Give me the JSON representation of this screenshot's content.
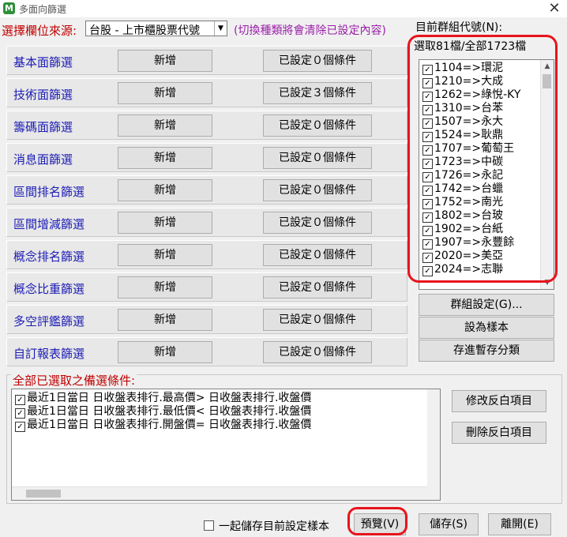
{
  "window": {
    "title": "多面向篩選",
    "app_icon": "M"
  },
  "source": {
    "label": "選擇欄位來源:",
    "value": "台股 - 上市櫃股票代號",
    "note": "(切換種類將會清除已設定內容)"
  },
  "filters": [
    {
      "label": "基本面篩選",
      "add": "新增",
      "count": "已設定０個條件"
    },
    {
      "label": "技術面篩選",
      "add": "新增",
      "count": "已設定３個條件"
    },
    {
      "label": "籌碼面篩選",
      "add": "新增",
      "count": "已設定０個條件"
    },
    {
      "label": "消息面篩選",
      "add": "新增",
      "count": "已設定０個條件"
    },
    {
      "label": "區間排名篩選",
      "add": "新增",
      "count": "已設定０個條件"
    },
    {
      "label": "區間增減篩選",
      "add": "新增",
      "count": "已設定０個條件"
    },
    {
      "label": "概念排名篩選",
      "add": "新增",
      "count": "已設定０個條件"
    },
    {
      "label": "概念比重篩選",
      "add": "新增",
      "count": "已設定０個條件"
    },
    {
      "label": "多空評鑑篩選",
      "add": "新增",
      "count": "已設定０個條件"
    },
    {
      "label": "自訂報表篩選",
      "add": "新增",
      "count": "已設定０個條件"
    }
  ],
  "group": {
    "label": "目前群組代號(N):",
    "count_text": "選取81檔/全部1723檔",
    "items": [
      "1104=>環泥",
      "1210=>大成",
      "1262=>綠悅-KY",
      "1310=>台苯",
      "1507=>永大",
      "1524=>耿鼎",
      "1707=>葡萄王",
      "1723=>中碳",
      "1726=>永記",
      "1742=>台蠟",
      "1752=>南光",
      "1802=>台玻",
      "1902=>台紙",
      "1907=>永豐餘",
      "2020=>美亞",
      "2024=>志聯"
    ],
    "buttons": {
      "settings": "群組設定(G)...",
      "sample": "設為樣本",
      "temp": "存進暫存分類"
    }
  },
  "conditions": {
    "label": "全部已選取之備選條件:",
    "items": [
      "最近1日當日 日收盤表排行.最高價> 日收盤表排行.收盤價",
      "最近1日當日 日收盤表排行.最低價< 日收盤表排行.收盤價",
      "最近1日當日 日收盤表排行.開盤價= 日收盤表排行.收盤價"
    ],
    "edit_button": "修改反白項目",
    "delete_button": "刪除反白項目"
  },
  "footer": {
    "save_sample_label": "一起儲存目前設定樣本",
    "preview": "預覽(V)",
    "save": "儲存(S)",
    "leave": "離開(E)"
  },
  "colors": {
    "highlight": "#e8141c",
    "filter_label": "#1c1cb5",
    "note": "#9b1fa9",
    "red_label": "#c00000"
  }
}
